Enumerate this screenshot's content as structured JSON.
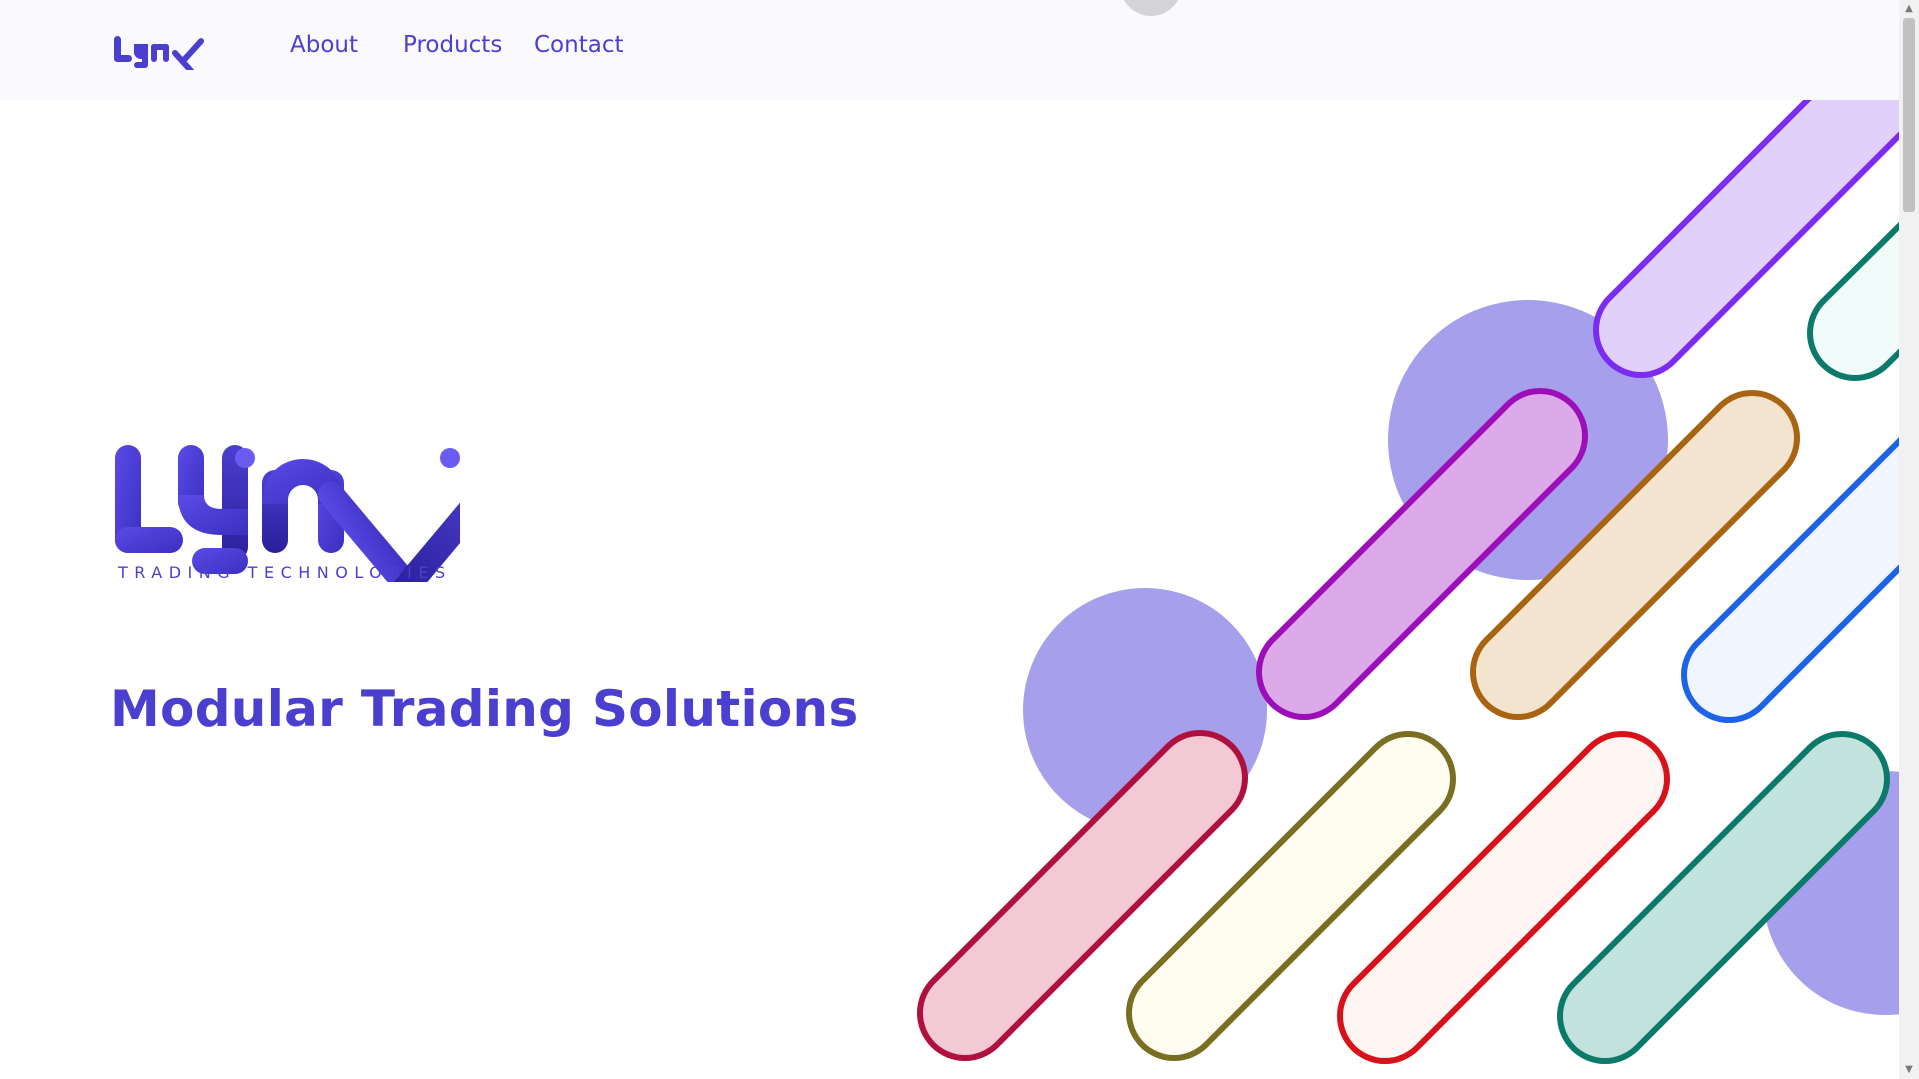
{
  "nav": {
    "logo_text": "LYNX",
    "links": [
      "About",
      "Products",
      "Contact"
    ]
  },
  "hero": {
    "logo_text": "LYNX",
    "logo_subtitle": "TRADING TECHNOLOGIES",
    "tagline": "Modular Trading Solutions"
  },
  "colors": {
    "brand": "#4b3fd0",
    "circle": "#a6a0ec",
    "pill_purple": "#7c2bf0",
    "pill_magenta": "#9c0fb8",
    "pill_orange": "#a86410",
    "pill_blue": "#1d63e6",
    "pill_teal": "#0b7a6a",
    "pill_crimson": "#b0103e",
    "pill_olive": "#7a6e22",
    "pill_red": "#d8121a"
  },
  "icons": {
    "scroll_up": "▲",
    "scroll_down": "▼"
  }
}
